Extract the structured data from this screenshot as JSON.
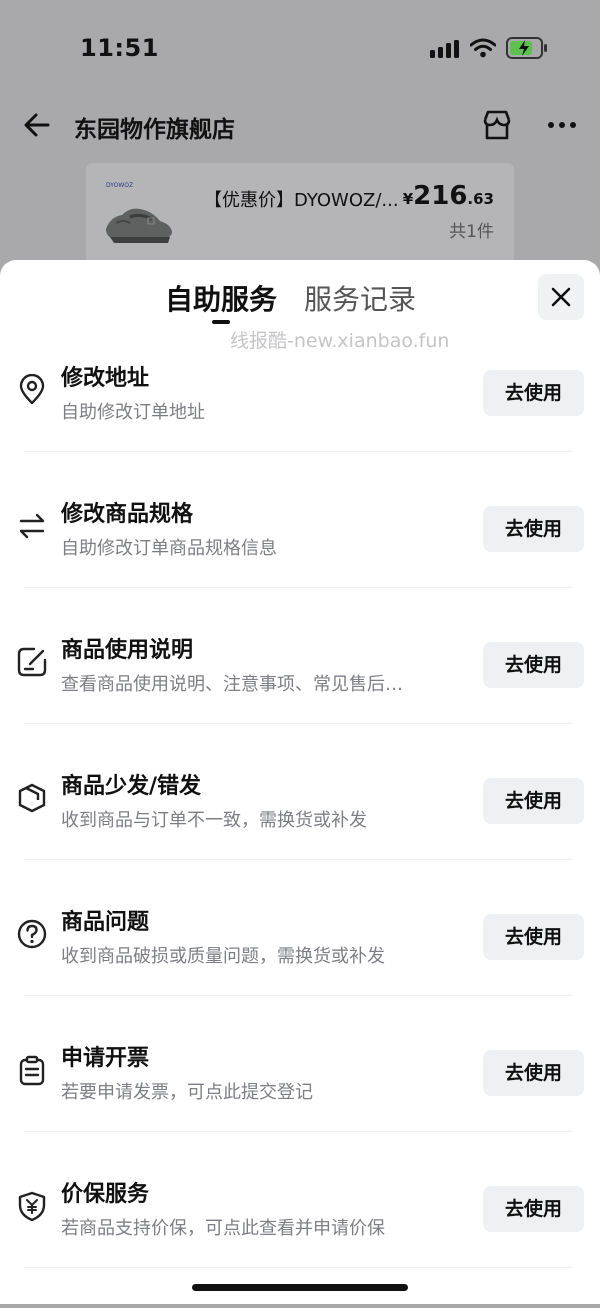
{
  "status_bar": {
    "time": "11:51"
  },
  "nav": {
    "shop_title": "东园物作旗舰店"
  },
  "product": {
    "name": "【优惠价】DYOWOZ/...",
    "price_currency": "¥",
    "price_int": "216",
    "price_dec": ".63",
    "quantity": "共1件",
    "image_brand": "DYOWOZ"
  },
  "sheet": {
    "tabs": [
      {
        "label": "自助服务"
      },
      {
        "label": "服务记录"
      }
    ],
    "watermark": "线报酷-new.xianbao.fun",
    "services": [
      {
        "title": "修改地址",
        "desc": "自助修改订单地址",
        "button": "去使用",
        "icon": "location-pin-icon"
      },
      {
        "title": "修改商品规格",
        "desc": "自助修改订单商品规格信息",
        "button": "去使用",
        "icon": "swap-arrows-icon"
      },
      {
        "title": "商品使用说明",
        "desc": "查看商品使用说明、注意事项、常见售后…",
        "button": "去使用",
        "icon": "edit-note-icon"
      },
      {
        "title": "商品少发/错发",
        "desc": "收到商品与订单不一致，需换货或补发",
        "button": "去使用",
        "icon": "package-icon"
      },
      {
        "title": "商品问题",
        "desc": "收到商品破损或质量问题，需换货或补发",
        "button": "去使用",
        "icon": "question-circle-icon"
      },
      {
        "title": "申请开票",
        "desc": "若要申请发票，可点此提交登记",
        "button": "去使用",
        "icon": "invoice-clipboard-icon"
      },
      {
        "title": "价保服务",
        "desc": "若商品支持价保，可点此查看并申请价保",
        "button": "去使用",
        "icon": "price-protect-shield-icon"
      }
    ]
  },
  "colors": {
    "accent_dark": "#111111",
    "muted_text": "#7d7f85",
    "button_bg": "#eef0f3"
  }
}
